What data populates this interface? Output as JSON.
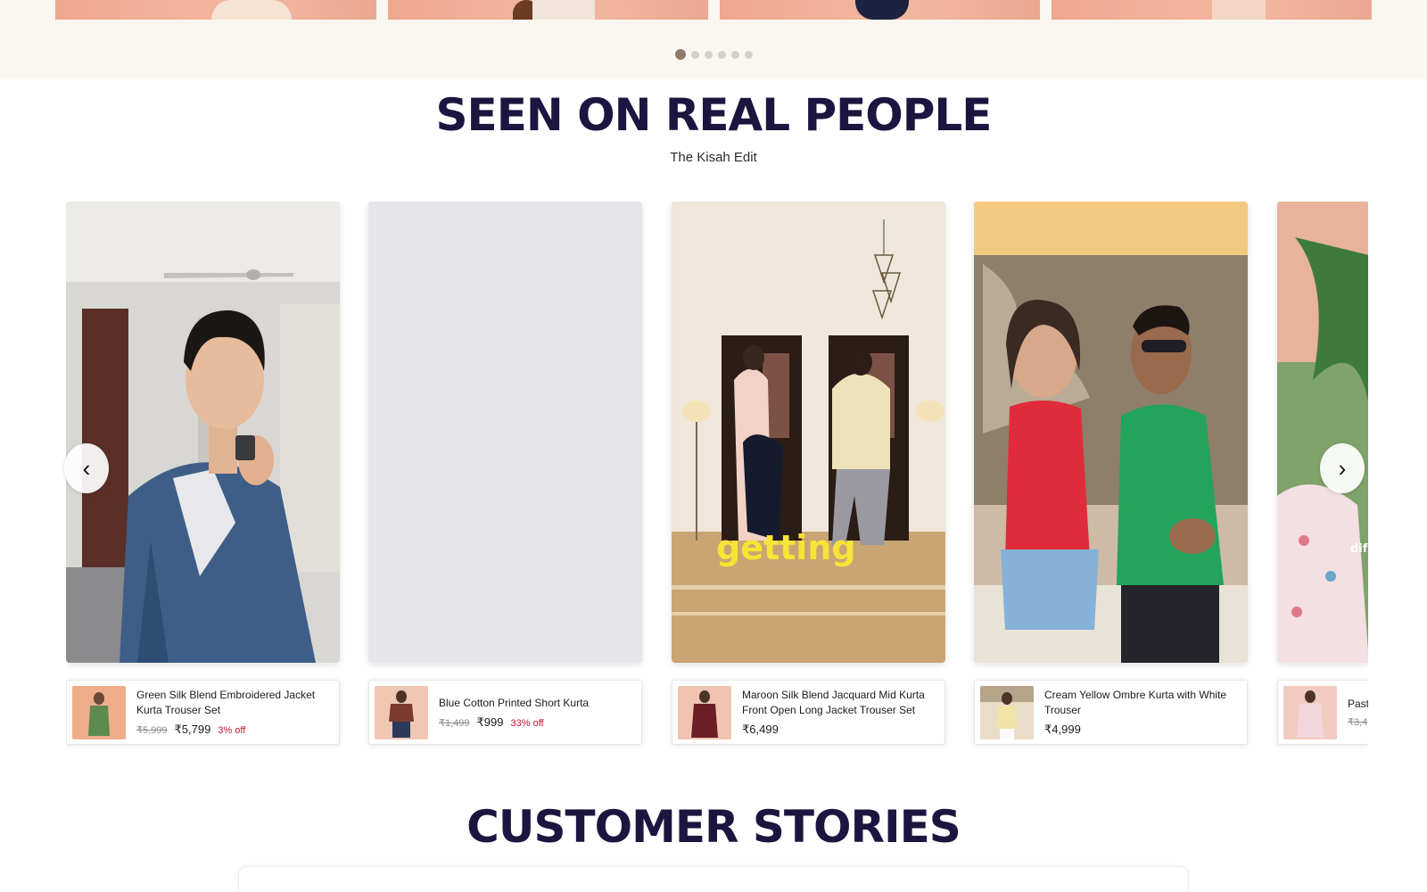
{
  "banner": {
    "dots_count": 6,
    "active_dot": 1
  },
  "seen_section": {
    "title": "SEEN ON REAL PEOPLE",
    "subtitle": "The Kisah Edit"
  },
  "videos": [
    {
      "overlay": ""
    },
    {
      "overlay": ""
    },
    {
      "overlay": "getting"
    },
    {
      "overlay": ""
    },
    {
      "overlay": "dif"
    }
  ],
  "products": [
    {
      "name": "Green Silk Blend Embroidered Jacket Kurta Trouser Set",
      "mrp": "₹5,999",
      "price": "₹5,799",
      "discount": "3% off"
    },
    {
      "name": "Blue Cotton Printed Short Kurta",
      "mrp": "₹1,499",
      "price": "₹999",
      "discount": "33% off"
    },
    {
      "name": "Maroon Silk Blend Jacquard Mid Kurta Front Open Long Jacket Trouser Set",
      "mrp": "",
      "price": "₹6,499",
      "discount": ""
    },
    {
      "name": "Cream Yellow Ombre Kurta with White Trouser",
      "mrp": "",
      "price": "₹4,999",
      "discount": ""
    },
    {
      "name": "Paste",
      "mrp": "₹3,4",
      "price": "",
      "discount": ""
    }
  ],
  "nav": {
    "prev_icon": "chevron-left-icon",
    "next_icon": "chevron-right-icon",
    "prev_glyph": "‹",
    "next_glyph": "›"
  },
  "stories_section": {
    "title": "CUSTOMER STORIES"
  },
  "colors": {
    "heading": "#1b1640",
    "discount": "#c8102e",
    "banner_bg": "#faf7f1"
  }
}
